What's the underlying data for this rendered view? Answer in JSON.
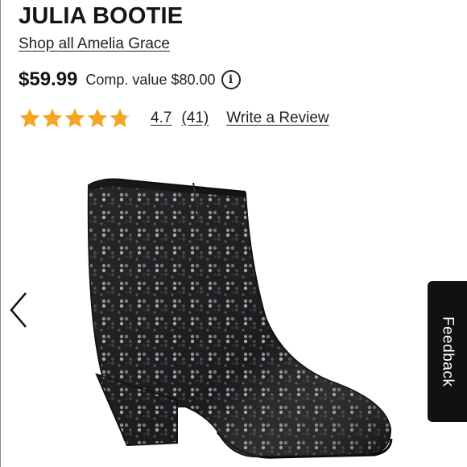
{
  "product": {
    "title": "JULIA BOOTIE",
    "brand_link": "Shop all Amelia Grace",
    "price": "$59.99",
    "comp_value": "Comp. value $80.00",
    "info_icon": "i"
  },
  "rating": {
    "value": "4.7",
    "count": "(41)",
    "stars_filled_fraction": 0.94,
    "write_review_label": "Write a Review",
    "star_color": "#f5a623"
  },
  "gallery": {
    "prev_icon": "chevron-left-icon"
  },
  "feedback": {
    "label": "Feedback"
  }
}
